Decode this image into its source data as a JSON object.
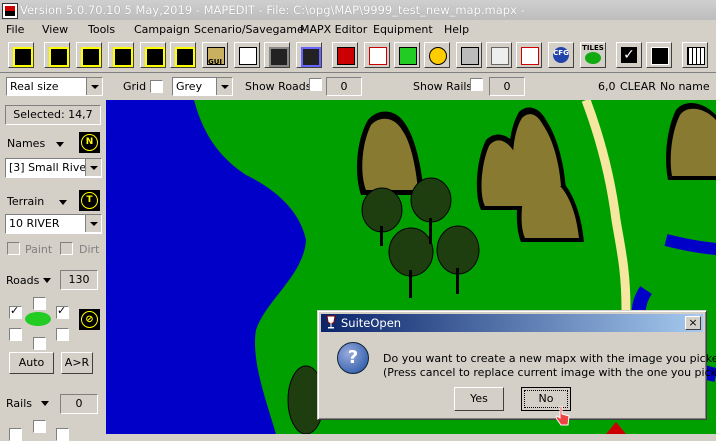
{
  "titlebar": {
    "title": "Version 5.0.70.10  5 May,2019 - MAPEDIT - File: C:\\opg\\MAP\\9999_test_new_map.mapx -"
  },
  "menu": [
    "File",
    "View",
    "Tools",
    "Campaign",
    "Scenario/Savegame",
    "MAPX Editor",
    "Equipment",
    "Help"
  ],
  "toolbar": {
    "gui_label": "GUI",
    "cfg_label": "CFG",
    "tiles_label": "TILES"
  },
  "options": {
    "zoom": "Real size",
    "grid_label": "Grid",
    "grid_color": "Grey",
    "show_roads_label": "Show Roads",
    "roads_value": "0",
    "show_rails_label": "Show Rails",
    "rails_value": "0",
    "status_coords": "6,0",
    "status_clear": "CLEAR",
    "status_name": "No name"
  },
  "left": {
    "selected": "Selected: 14,7",
    "names_label": "Names",
    "names_value": "[3]  Small River",
    "terrain_label": "Terrain",
    "terrain_value": "10 RIVER",
    "paint_label": "Paint",
    "dirt_label": "Dirt",
    "roads_label": "Roads",
    "roads_count": "130",
    "auto_button": "Auto",
    "ar_button": "A>R",
    "rails_label": "Rails",
    "rails_count": "0",
    "names_symbol": "N",
    "terrain_symbol": "T"
  },
  "dialog": {
    "title": "SuiteOpen",
    "message_line1": "Do you want to create a new mapx with the image you picked ?",
    "message_line2": "(Press cancel to replace current image with the one you picked)",
    "yes": "Yes",
    "no": "No",
    "close": "×"
  },
  "colors": {
    "grass": "#00a000",
    "water": "#0000c8",
    "title_blue": "#0a246a",
    "road": "#f5e6a0"
  }
}
